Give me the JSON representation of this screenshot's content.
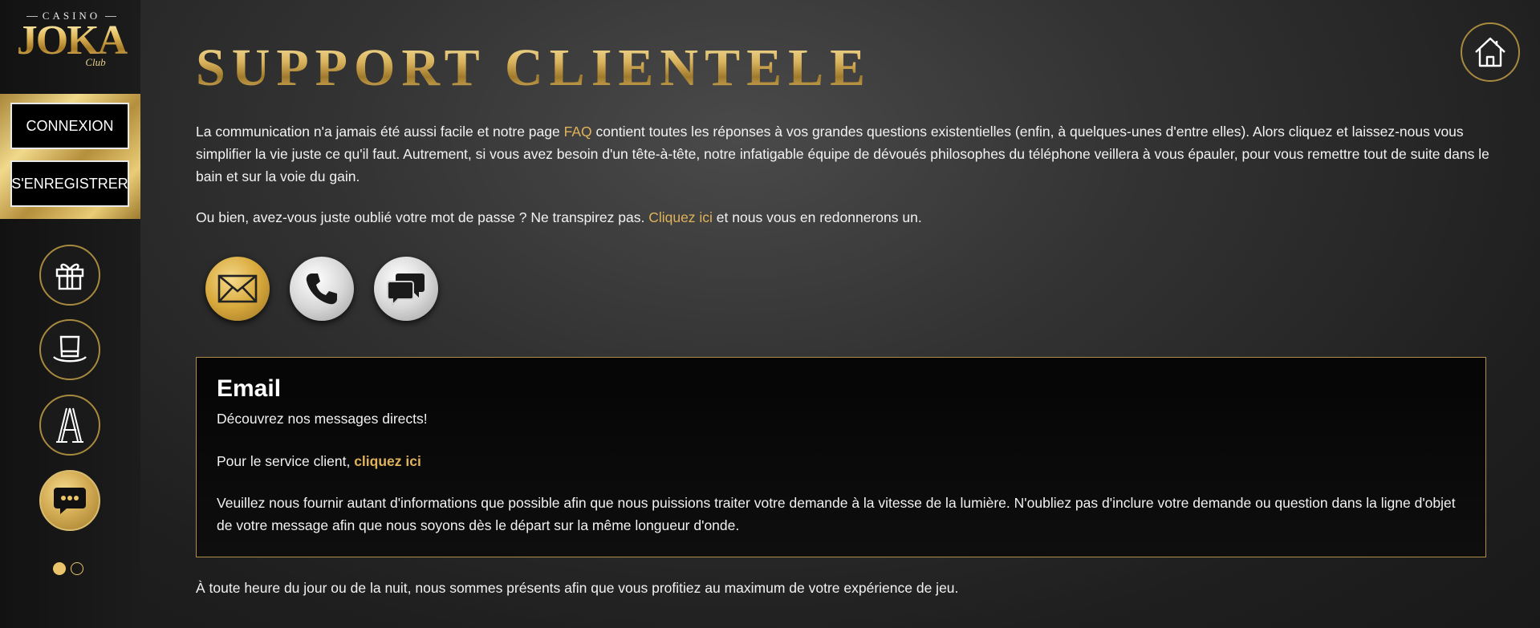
{
  "logo": {
    "casino": "CASINO",
    "name": "JOKA",
    "club": "Club"
  },
  "auth": {
    "login_label": "CONNEXION",
    "register_label": "S'ENREGISTRER"
  },
  "sidebar": {
    "icons": [
      {
        "name": "gift-icon",
        "active": false
      },
      {
        "name": "top-hat-icon",
        "active": false
      },
      {
        "name": "ace-card-icon",
        "active": false
      },
      {
        "name": "chat-bubble-icon",
        "active": true
      }
    ]
  },
  "page": {
    "title": "SUPPORT CLIENTELE",
    "intro": {
      "before_link": "La communication n'a jamais été aussi facile et notre page ",
      "link": "FAQ",
      "after_link": " contient toutes les réponses à vos grandes questions existentielles (enfin, à quelques-unes d'entre elles). Alors cliquez et laissez-nous vous simplifier la vie juste ce qu'il faut. Autrement, si vous avez besoin d'un tête-à-tête, notre infatigable équipe de dévoués philosophes du téléphone veillera à vous épauler, pour vous remettre tout de suite dans le bain et sur la voie du gain."
    },
    "password": {
      "before_link": "Ou bien, avez-vous juste oublié votre mot de passe ? Ne transpirez pas. ",
      "link": "Cliquez ici",
      "after_link": " et nous vous en redonnerons un."
    },
    "contact_options": [
      "email-icon",
      "phone-icon",
      "live-chat-icon"
    ],
    "email_box": {
      "heading": "Email",
      "subheading": "Découvrez nos messages directs!",
      "service_text": "Pour le service client, ",
      "service_link": "cliquez ici",
      "instructions": "Veuillez nous fournir autant d'informations que possible afin que nous puissions traiter votre demande à la vitesse de la lumière. N'oubliez pas d'inclure votre demande ou question dans la ligne d'objet de votre message afin que nous soyons dès le départ sur la même longueur d'onde."
    },
    "footer": "À toute heure du jour ou de la nuit, nous sommes présents afin que vous profitiez au maximum de votre expérience de jeu."
  },
  "colors": {
    "gold": "#e0b35a",
    "background": "#2a2a2a",
    "box_border": "#b08f45"
  }
}
